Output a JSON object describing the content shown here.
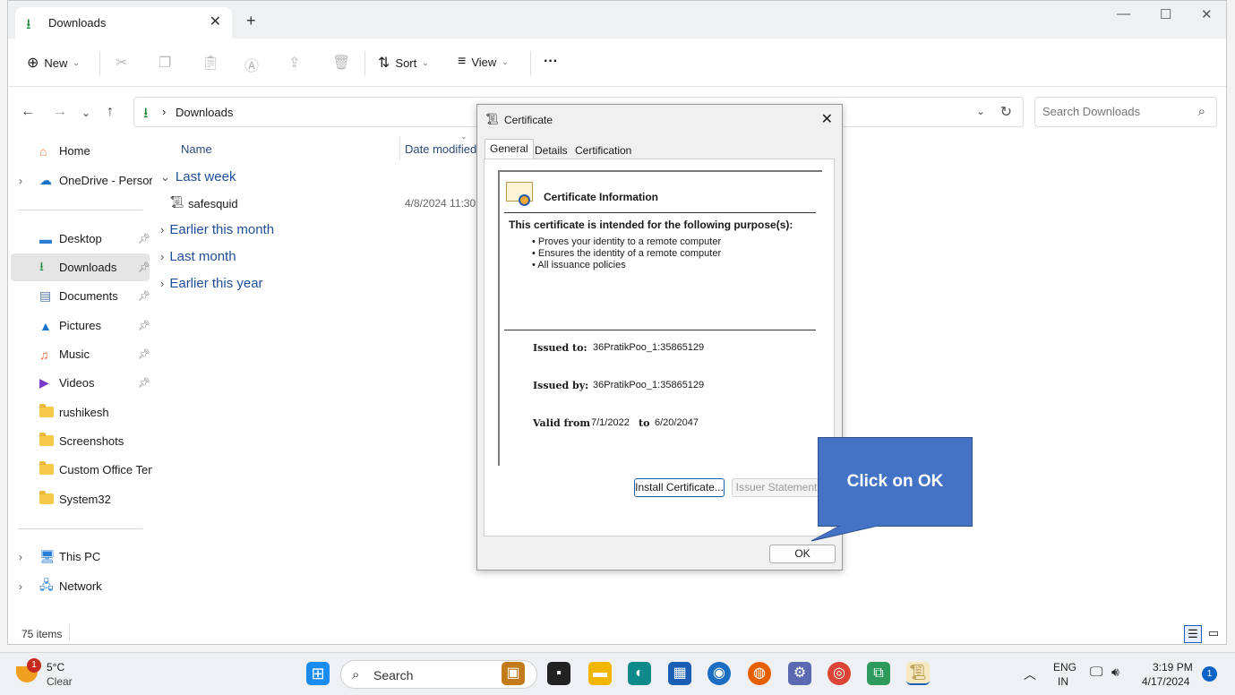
{
  "tab": {
    "title": "Downloads"
  },
  "toolbar": {
    "new_label": "New",
    "sort_label": "Sort",
    "view_label": "View",
    "more_label": "···"
  },
  "address": {
    "location": "Downloads"
  },
  "search": {
    "placeholder": "Search Downloads"
  },
  "sidebar": {
    "items": [
      {
        "label": "Home"
      },
      {
        "label": "OneDrive - Persona"
      },
      {
        "label": "Desktop"
      },
      {
        "label": "Downloads"
      },
      {
        "label": "Documents"
      },
      {
        "label": "Pictures"
      },
      {
        "label": "Music"
      },
      {
        "label": "Videos"
      },
      {
        "label": "rushikesh"
      },
      {
        "label": "Screenshots"
      },
      {
        "label": "Custom Office Tem"
      },
      {
        "label": "System32"
      },
      {
        "label": "This PC"
      },
      {
        "label": "Network"
      }
    ]
  },
  "list": {
    "col_name": "Name",
    "col_date": "Date modified",
    "groups": [
      {
        "label": "Last week"
      },
      {
        "label": "Earlier this month"
      },
      {
        "label": "Last month"
      },
      {
        "label": "Earlier this year"
      }
    ],
    "file": {
      "name": "safesquid",
      "date": "4/8/2024 11:30 AM"
    }
  },
  "status": {
    "items": "75 items"
  },
  "dialog": {
    "title": "Certificate",
    "tabs": [
      "General",
      "Details",
      "Certification Path"
    ],
    "heading": "Certificate Information",
    "purpose": "This certificate is intended for the following purpose(s):",
    "bullets": [
      "• Proves your identity to a remote computer",
      "• Ensures the identity of a remote computer",
      "• All issuance policies"
    ],
    "issued_to_label": "Issued to:",
    "issued_to": "36PratikPoo_1:35865129",
    "issued_by_label": "Issued by:",
    "issued_by": "36PratikPoo_1:35865129",
    "valid_from_label": "Valid from",
    "valid_from": "7/1/2022",
    "to_label": "to",
    "valid_to": "6/20/2047",
    "install_btn": "Install Certificate...",
    "issuer_btn": "Issuer Statement",
    "ok_btn": "OK"
  },
  "callout": {
    "text": "Click on OK"
  },
  "taskbar": {
    "weather_temp": "5°C",
    "weather_cond": "Clear",
    "weather_badge": "1",
    "search_label": "Search",
    "lang_top": "ENG",
    "lang_bottom": "IN",
    "time": "3:19 PM",
    "date": "4/17/2024",
    "notif_count": "1"
  },
  "colors": {
    "accent": "#1f4e99",
    "callout": "#4472c4",
    "download_green": "#1e8a3c"
  }
}
